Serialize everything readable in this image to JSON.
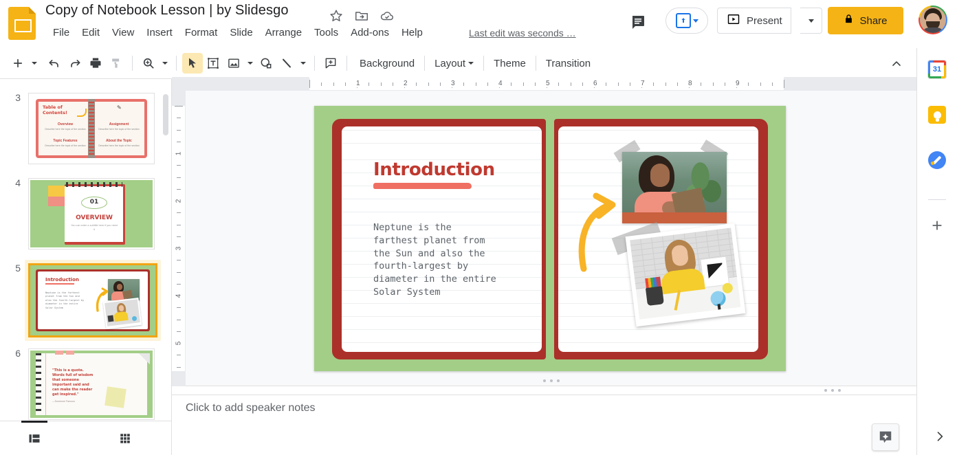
{
  "header": {
    "doc_title": "Copy of Notebook Lesson | by Slidesgo",
    "title_icons": [
      {
        "name": "star-icon",
        "label": "Star"
      },
      {
        "name": "move-to-folder-icon",
        "label": "Move"
      },
      {
        "name": "cloud-saved-icon",
        "label": "Saved to Drive"
      }
    ],
    "menus": [
      "File",
      "Edit",
      "View",
      "Insert",
      "Format",
      "Slide",
      "Arrange",
      "Tools",
      "Add-ons",
      "Help"
    ],
    "last_edit": "Last edit was seconds …",
    "comment_label": "Open comment history",
    "meet_label": "Join or present to a meeting",
    "present_label": "Present",
    "share_label": "Share",
    "avatar_label": "Google Account"
  },
  "toolbar": {
    "new_slide_label": "New slide",
    "undo_label": "Undo",
    "redo_label": "Redo",
    "print_label": "Print",
    "paint_format_label": "Paint format",
    "zoom_label": "Zoom",
    "select_label": "Select",
    "textbox_label": "Text box",
    "image_label": "Insert image",
    "shape_label": "Shape",
    "line_label": "Line",
    "comment_label": "Add comment",
    "background_label": "Background",
    "layout_label": "Layout",
    "theme_label": "Theme",
    "transition_label": "Transition",
    "collapse_label": "Hide the menus"
  },
  "right_rail": {
    "items": [
      {
        "name": "google-calendar-icon",
        "label": "Calendar",
        "badge": "31"
      },
      {
        "name": "google-keep-icon",
        "label": "Keep"
      },
      {
        "name": "google-tasks-icon",
        "label": "Tasks"
      }
    ],
    "add_label": "Get add-ons"
  },
  "filmstrip": {
    "selected_index": 5,
    "slides": [
      {
        "number": "3",
        "title": "Table of Contents!",
        "selected": false,
        "sections": [
          {
            "heading": "Overview",
            "body": "Describe here the topic of the section"
          },
          {
            "heading": "Assignment",
            "body": "Describe here the topic of the section"
          },
          {
            "heading": "Topic Features",
            "body": "Describe here the topic of the section"
          },
          {
            "heading": "About the Topic",
            "body": "Describe here the topic of the section"
          }
        ]
      },
      {
        "number": "4",
        "title": "OVERVIEW",
        "number_badge": "01",
        "selected": false,
        "body": "You can enter a subtitle here if you need it"
      },
      {
        "number": "5",
        "title": "Introduction",
        "selected": true,
        "body": "Neptune is the farthest planet from the Sun and also the fourth-largest by diameter in the entire Solar System"
      },
      {
        "number": "6",
        "title": "",
        "selected": false,
        "quote": "\"This is a quote. Words full of wisdom that someone important said and can make the reader get inspired.\"",
        "attribution": "—Someone Famous"
      }
    ],
    "view_filmstrip_label": "Filmstrip view",
    "view_grid_label": "Grid view"
  },
  "ruler": {
    "horizontal_numbers": [
      "1",
      "2",
      "3",
      "4",
      "5",
      "6",
      "7",
      "8",
      "9"
    ],
    "vertical_numbers": [
      "1",
      "2",
      "3",
      "4",
      "5"
    ],
    "units": "inches"
  },
  "slide": {
    "title": "Introduction",
    "body": "Neptune is the\nfarthest planet from\nthe Sun and also the\nfourth-largest by\ndiameter in the entire\nSolar System",
    "photos": [
      {
        "name": "photo-woman-reading",
        "alt": "Woman reading a book outdoors"
      },
      {
        "name": "photo-student-desk",
        "alt": "Student writing at a desk with pencils and globe"
      }
    ],
    "decoration": "yellow-curved-arrow",
    "colors": {
      "background_green": "#a3ce87",
      "cover_red": "#ab3029",
      "title_red": "#c0392f",
      "underline_red": "#ef6f63",
      "body_gray": "#5c6268",
      "accent_yellow": "#f5b315"
    }
  },
  "notes": {
    "placeholder": "Click to add speaker notes"
  },
  "footer": {
    "explore_label": "Explore",
    "expand_label": "Show side panel"
  }
}
